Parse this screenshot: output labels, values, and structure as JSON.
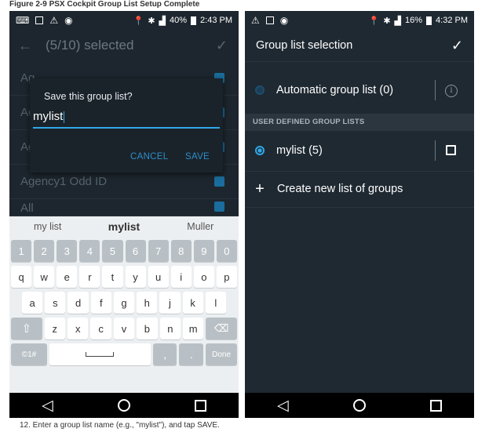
{
  "figure": {
    "caption": "Figure 2-9 PSX Cockpit Group List Setup Complete"
  },
  "left": {
    "status": {
      "battery": "40%",
      "time": "2:43 PM"
    },
    "appbar": {
      "title": "(5/10) selected"
    },
    "list": [
      {
        "label": "Ag"
      },
      {
        "label": "Ac"
      },
      {
        "label": "Ag"
      },
      {
        "label": "Agency1 Odd ID"
      },
      {
        "label": "All"
      }
    ],
    "dialog": {
      "title": "Save this group list?",
      "value": "mylist",
      "cancel": "CANCEL",
      "save": "SAVE"
    },
    "keyboard": {
      "suggestions": [
        "my list",
        "mylist",
        "Muller"
      ],
      "numbers": [
        "1",
        "2",
        "3",
        "4",
        "5",
        "6",
        "7",
        "8",
        "9",
        "0"
      ],
      "row1": [
        "q",
        "w",
        "e",
        "r",
        "t",
        "y",
        "u",
        "i",
        "o",
        "p"
      ],
      "row2": [
        "a",
        "s",
        "d",
        "f",
        "g",
        "h",
        "j",
        "k",
        "l"
      ],
      "row3": [
        "z",
        "x",
        "c",
        "v",
        "b",
        "n",
        "m"
      ],
      "symbols_key": "©1#",
      "comma": ",",
      "period": ".",
      "done": "Done"
    }
  },
  "right": {
    "status": {
      "battery": "16%",
      "time": "4:32 PM"
    },
    "appbar": {
      "title": "Group list selection"
    },
    "automatic": {
      "label": "Automatic group list (0)"
    },
    "section": {
      "label": "USER DEFINED GROUP LISTS"
    },
    "user_lists": [
      {
        "label": "mylist (5)"
      }
    ],
    "create": {
      "label": "Create new list of groups"
    }
  },
  "footnote": "12. Enter a group list name (e.g., \"mylist\"), and tap SAVE."
}
